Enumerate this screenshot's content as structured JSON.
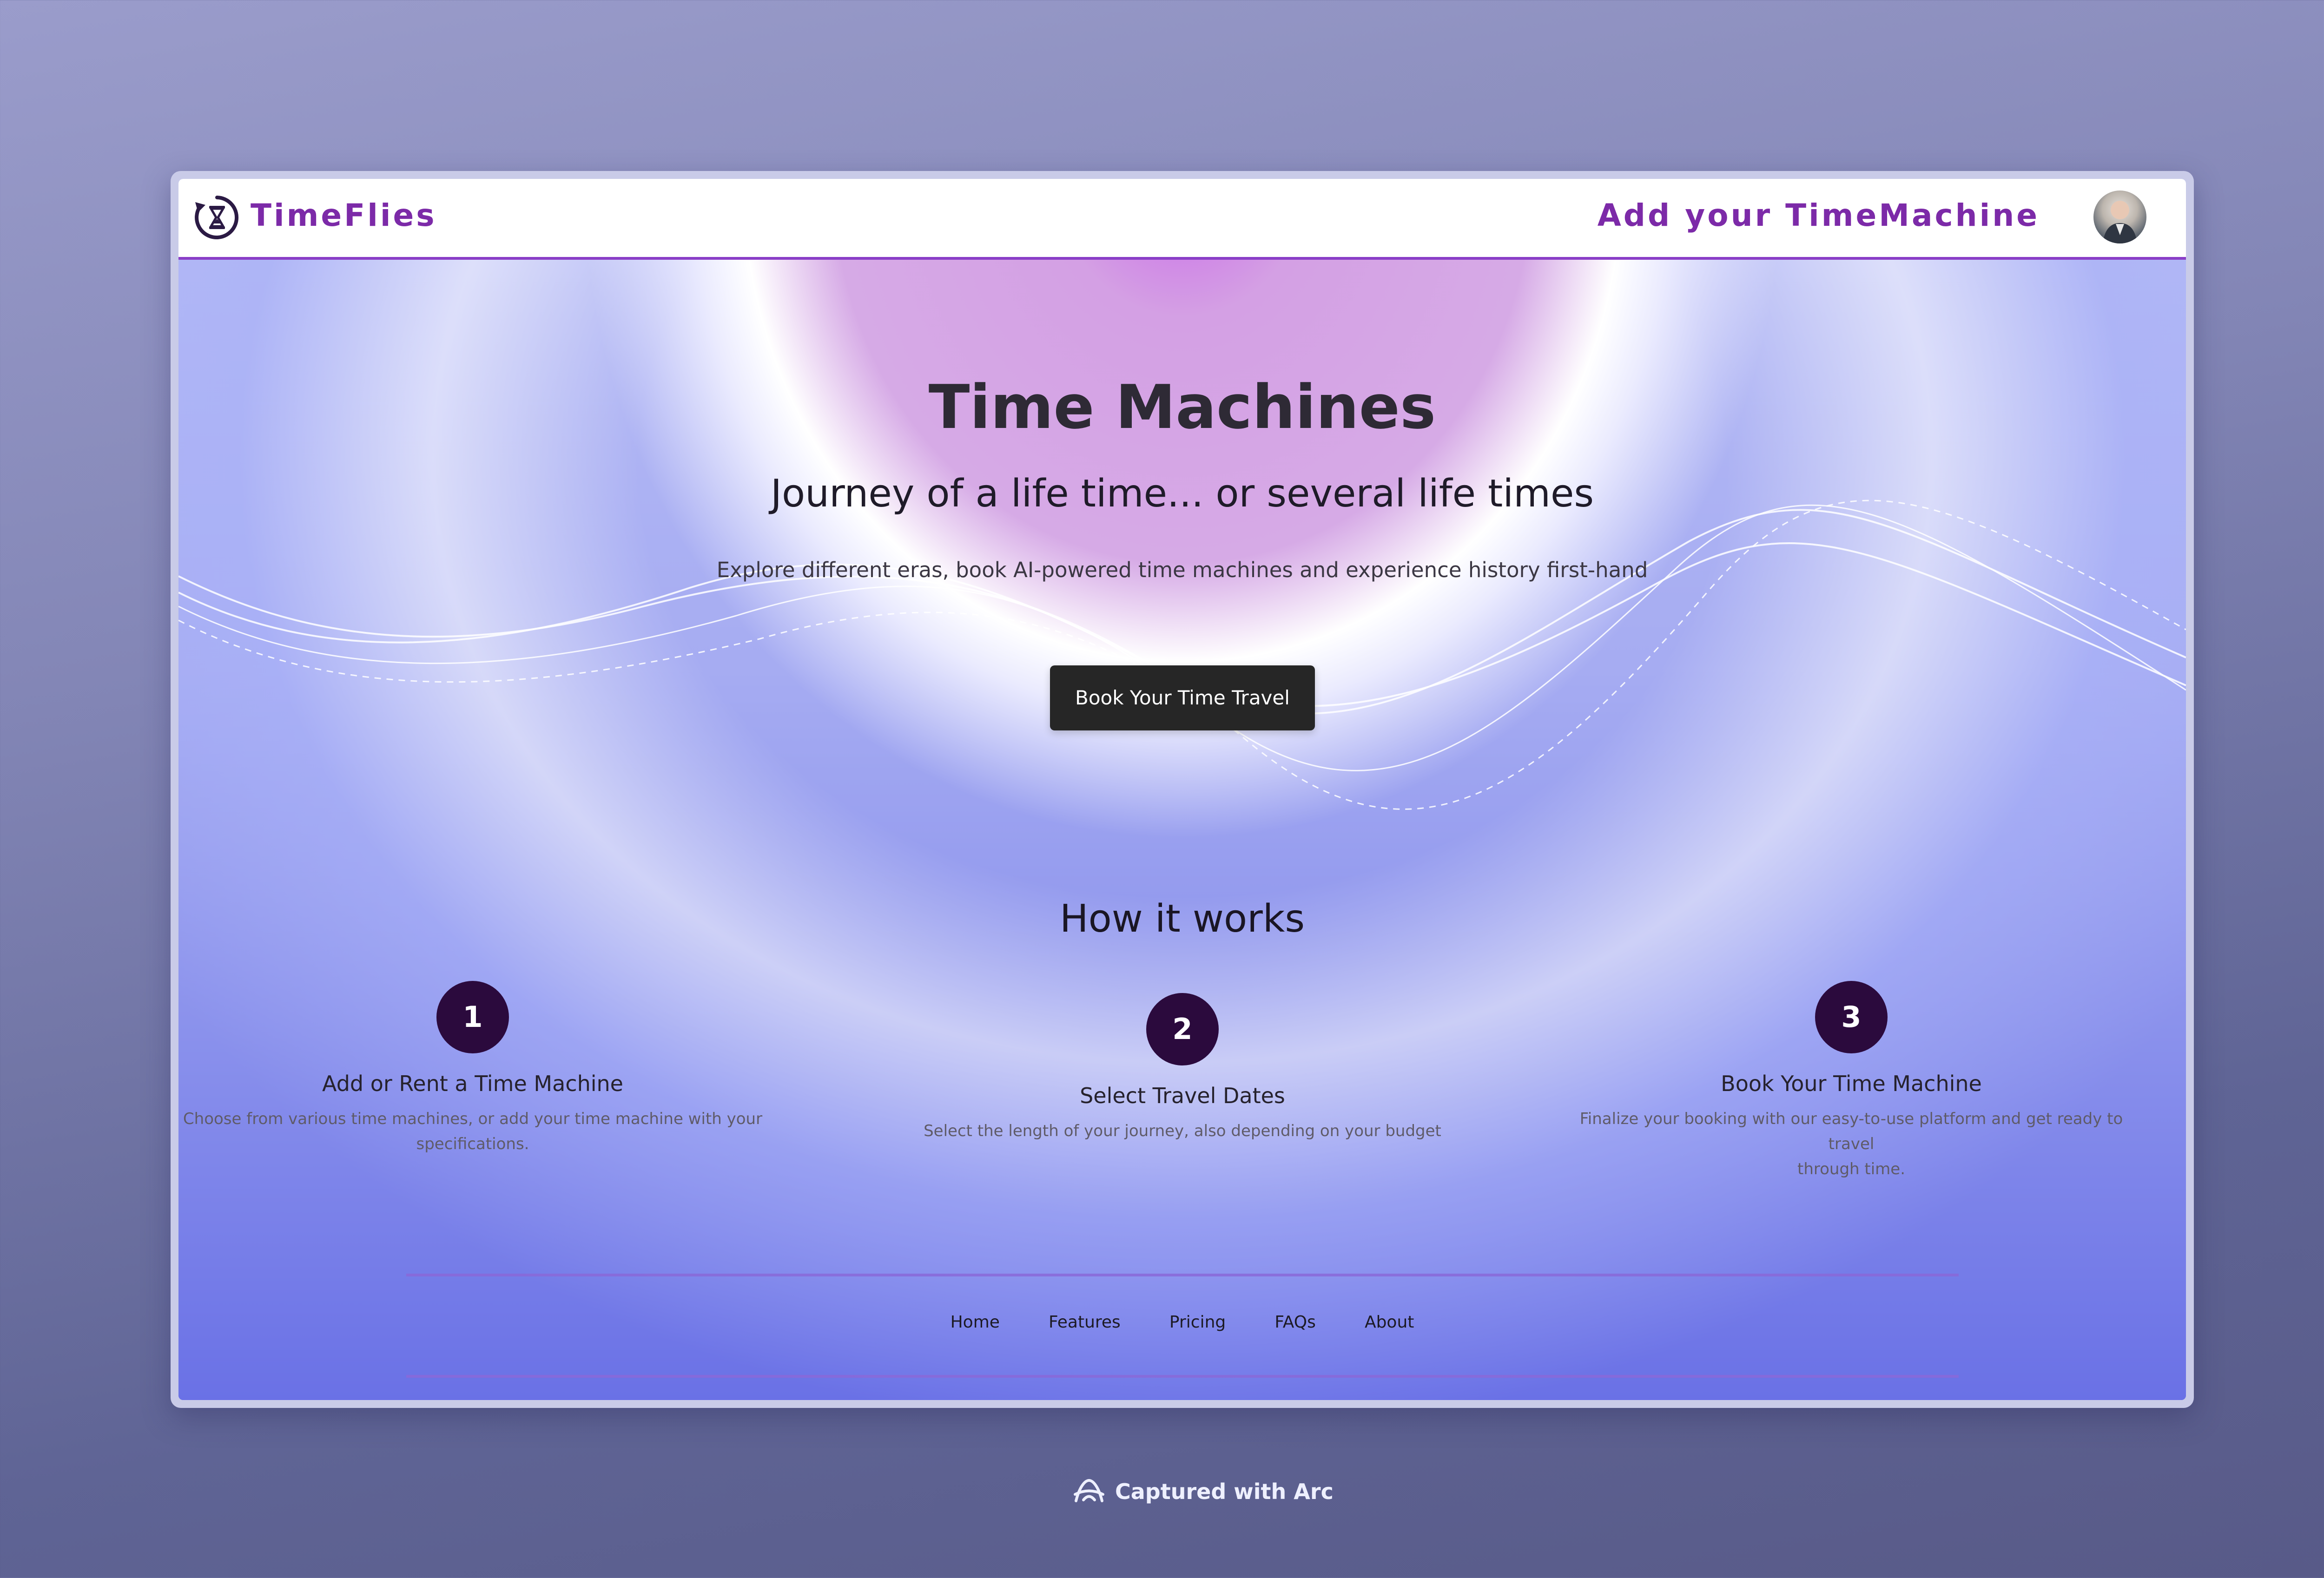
{
  "brand": {
    "name": "TimeFlies",
    "logo_icon": "hourglass-refresh-icon"
  },
  "header": {
    "add_link": "Add your TimeMachine",
    "avatar_icon": "user-avatar"
  },
  "hero": {
    "title": "Time Machines",
    "subtitle": "Journey of a life time... or several life times",
    "description": "Explore different eras, book AI-powered time machines and experience history first-hand",
    "cta_label": "Book Your Time Travel"
  },
  "how": {
    "title": "How it works",
    "steps": [
      {
        "number": "1",
        "title": "Add or Rent a Time Machine",
        "desc_line1": "Choose from various time machines, or add your time machine with your",
        "desc_line2": "specifications."
      },
      {
        "number": "2",
        "title": "Select Travel Dates",
        "desc_line1": "Select the length of your journey, also depending on your budget",
        "desc_line2": ""
      },
      {
        "number": "3",
        "title": "Book Your Time Machine",
        "desc_line1": "Finalize your booking with our easy-to-use platform and get ready to travel",
        "desc_line2": "through time."
      }
    ]
  },
  "footer": {
    "links": [
      "Home",
      "Features",
      "Pricing",
      "FAQs",
      "About"
    ]
  },
  "capture": {
    "text": "Captured with Arc",
    "icon": "arc-browser-icon"
  },
  "colors": {
    "brand_purple": "#7c2aa8",
    "header_border": "#8a3ec7",
    "step_circle": "#2b0a3d",
    "cta_background": "#262626"
  }
}
